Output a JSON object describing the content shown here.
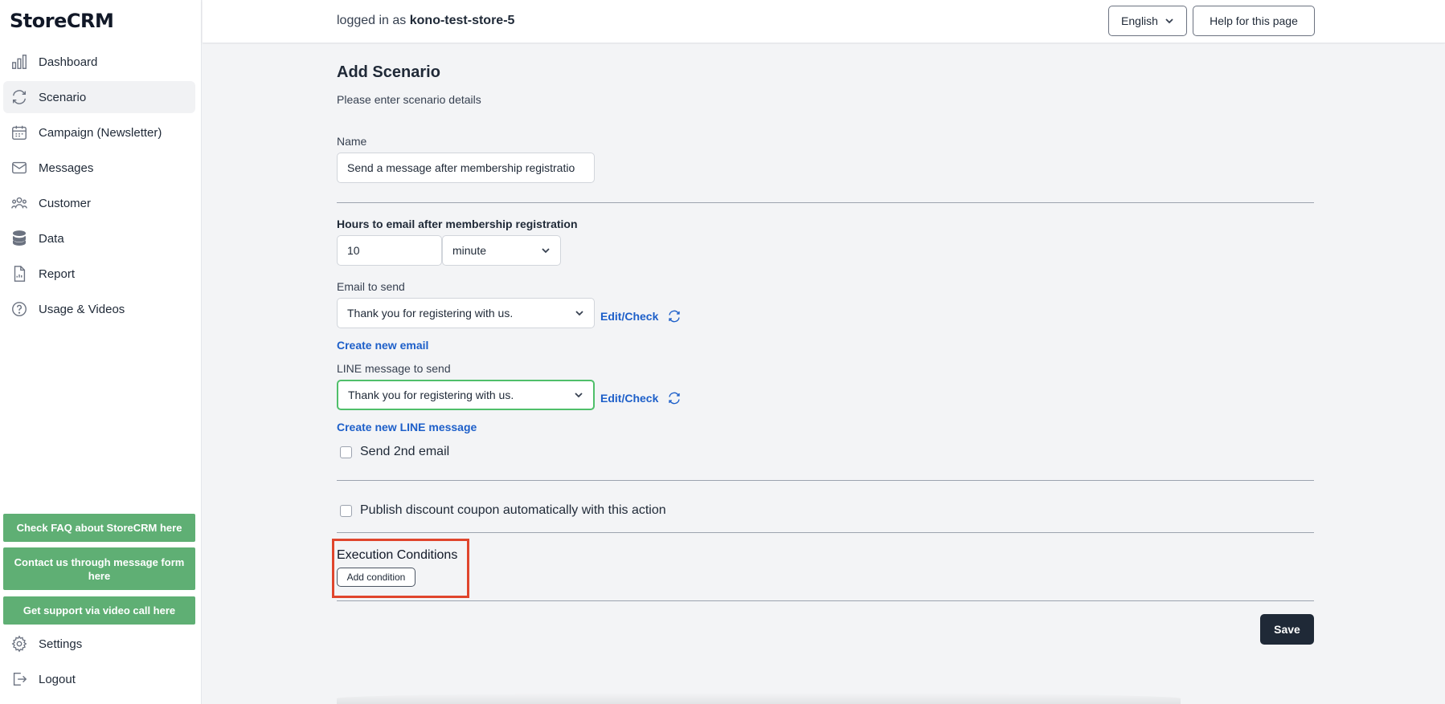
{
  "app": {
    "logo": "StoreCRM"
  },
  "sidebar": {
    "items": [
      {
        "label": "Dashboard",
        "icon": "bar-chart-icon"
      },
      {
        "label": "Scenario",
        "icon": "refresh-icon",
        "active": true
      },
      {
        "label": "Campaign (Newsletter)",
        "icon": "calendar-icon"
      },
      {
        "label": "Messages",
        "icon": "mail-icon"
      },
      {
        "label": "Customer",
        "icon": "users-icon"
      },
      {
        "label": "Data",
        "icon": "database-icon"
      },
      {
        "label": "Report",
        "icon": "document-icon"
      },
      {
        "label": "Usage & Videos",
        "icon": "help-circle-icon"
      }
    ],
    "help_buttons": [
      "Check FAQ about StoreCRM here",
      "Contact us through message form here",
      "Get support via video call here"
    ],
    "settings_label": "Settings",
    "logout_label": "Logout"
  },
  "header": {
    "logged_prefix": "logged in as",
    "username": "kono-test-store-5",
    "language": "English",
    "help_label": "Help for this page"
  },
  "form": {
    "title": "Add Scenario",
    "subtitle": "Please enter scenario details",
    "name_label": "Name",
    "name_value": "Send a message after membership registratio",
    "hours_label": "Hours to email after membership registration",
    "hours_value": "10",
    "unit_value": "minute",
    "email_label": "Email to send",
    "email_value": "Thank you for registering with us.",
    "edit_check": "Edit/Check",
    "create_email": "Create new email",
    "line_label": "LINE message to send",
    "line_value": "Thank you for registering with us.",
    "create_line": "Create new LINE message",
    "second_email": "Send 2nd email",
    "coupon": "Publish discount coupon automatically with this action",
    "exec_title": "Execution Conditions",
    "add_condition": "Add condition",
    "save": "Save"
  },
  "colors": {
    "accent_link": "#1d5fc9",
    "help_green": "#5faf74",
    "highlight_red": "#e0452d",
    "save_dark": "#1f2937"
  }
}
